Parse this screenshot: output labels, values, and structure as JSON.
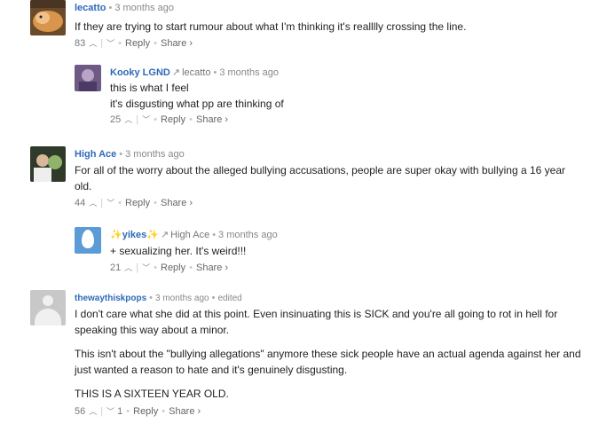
{
  "comments": [
    {
      "author": "lecatto",
      "time": "3 months ago",
      "text": [
        "If they are trying to start rumour about what I'm thinking it's realllly crossing the line."
      ],
      "votes": "83",
      "reply": "Reply",
      "share": "Share ›"
    },
    {
      "author": "Kooky LGND",
      "reply_to": "lecatto",
      "time": "3 months ago",
      "text": [
        "this is what I feel",
        "it's disgusting what pp are thinking of"
      ],
      "votes": "25",
      "reply": "Reply",
      "share": "Share ›"
    },
    {
      "author": "High Ace",
      "time": "3 months ago",
      "text": [
        "For all of the worry about the alleged bullying accusations, people are super okay with bullying a 16 year old."
      ],
      "votes": "44",
      "reply": "Reply",
      "share": "Share ›"
    },
    {
      "author": "yikes",
      "author_emoji": "✨",
      "reply_to": "High Ace",
      "time": "3 months ago",
      "text": [
        "+ sexualizing her. It's weird!!!"
      ],
      "votes": "21",
      "reply": "Reply",
      "share": "Share ›"
    },
    {
      "author": "thewaythiskpops",
      "time": "3 months ago",
      "edited": "edited",
      "text": [
        "I don't care what she did at this point. Even insinuating this is SICK and you're all going to rot in hell for speaking this way about a minor.",
        "This isn't about the \"bullying allegations\" anymore these sick people have an actual agenda against her and just wanted a reason to hate and it's genuinely disgusting.",
        "THIS IS A SIXTEEN YEAR OLD."
      ],
      "votes": "56",
      "downvotes": "1",
      "reply": "Reply",
      "share": "Share ›"
    }
  ],
  "colors": {
    "author": "#2e6ab8",
    "meta": "#888888",
    "egg_avatar": "#5b9bd6"
  }
}
